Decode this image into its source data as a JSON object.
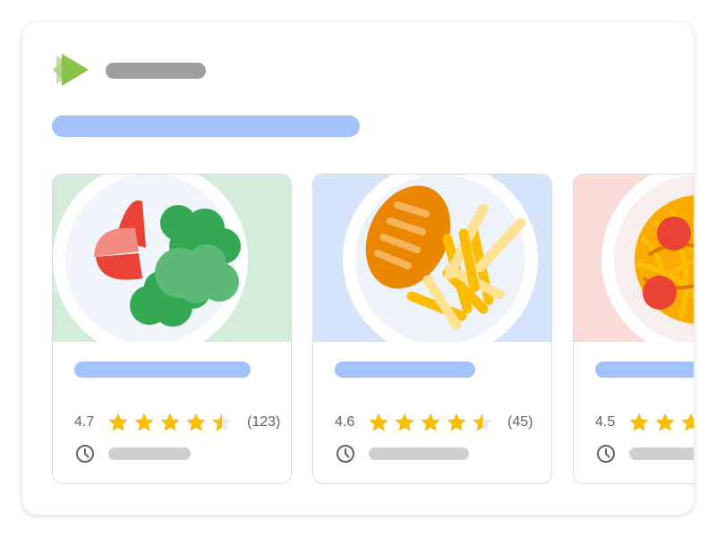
{
  "brand": {
    "logo_icon": "play-triangle-logo-icon",
    "accent_green": "#8bc34a",
    "placeholder_gray": "#9e9e9e",
    "placeholder_blue": "#a1c2fa",
    "star_color": "#fbbc04"
  },
  "cards": [
    {
      "image_icon": "salad-plate-icon",
      "thumb_color": "#d4edda",
      "rating": "4.7",
      "rating_value": 4.5,
      "review_count": "(123)",
      "time_icon": "clock-icon"
    },
    {
      "image_icon": "sausage-fries-plate-icon",
      "thumb_color": "#d6e4fb",
      "rating": "4.6",
      "rating_value": 4.5,
      "review_count": "(45)",
      "time_icon": "clock-icon"
    },
    {
      "image_icon": "spaghetti-plate-icon",
      "thumb_color": "#fadbd8",
      "rating": "4.5",
      "rating_value": 4.5,
      "review_count": "",
      "time_icon": "clock-icon"
    }
  ]
}
